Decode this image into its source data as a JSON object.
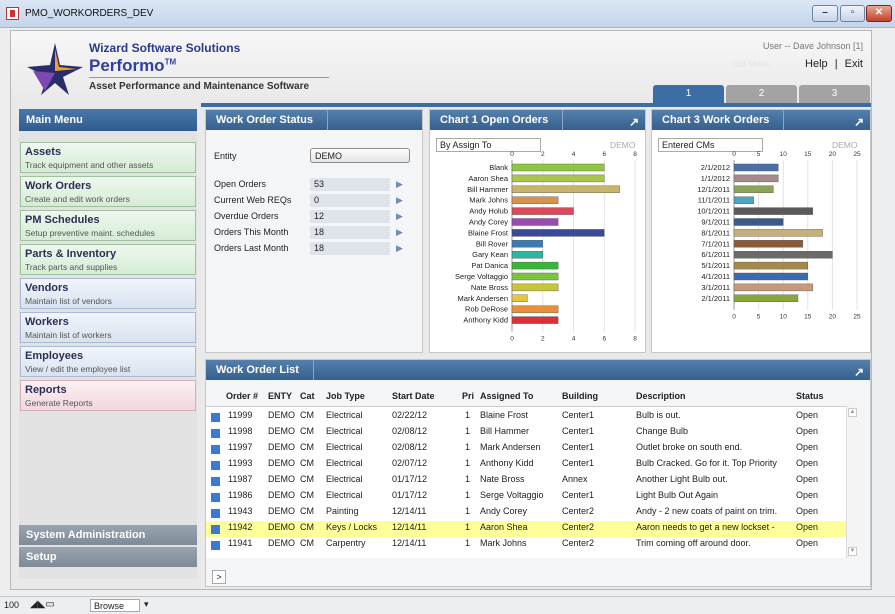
{
  "window": {
    "title": "PMO_WORKORDERS_DEV",
    "min": "–",
    "max": "▫",
    "close": "✕"
  },
  "header": {
    "company": "Wizard Software Solutions",
    "product": "Performo",
    "tm": "TM",
    "tagline": "Asset Performance and Maintenance Software",
    "user": "User -- Dave Johnson [1]",
    "old_menu": "Old Menu",
    "help": "Help",
    "sep": "|",
    "exit": "Exit",
    "tabs": [
      "1",
      "2",
      "3"
    ]
  },
  "sidebar": {
    "title": "Main Menu",
    "items": [
      {
        "title": "Assets",
        "sub": "Track equipment and other assets",
        "style": "green"
      },
      {
        "title": "Work Orders",
        "sub": "Create and edit work orders",
        "style": "green"
      },
      {
        "title": "PM Schedules",
        "sub": "Setup preventive maint. schedules",
        "style": "green"
      },
      {
        "title": "Parts & Inventory",
        "sub": "Track parts and supplies",
        "style": "green"
      },
      {
        "title": "Vendors",
        "sub": "Maintain list of vendors",
        "style": "blue"
      },
      {
        "title": "Workers",
        "sub": "Maintain list of workers",
        "style": "blue"
      },
      {
        "title": "Employees",
        "sub": "View / edit the employee list",
        "style": "blue"
      },
      {
        "title": "Reports",
        "sub": "Generate Reports",
        "style": "pink"
      }
    ],
    "system_admin": "System Administration",
    "setup": "Setup"
  },
  "work_order_status": {
    "title": "Work Order Status",
    "entity_label": "Entity",
    "entity_value": "DEMO",
    "rows": [
      {
        "label": "Open Orders",
        "value": "53"
      },
      {
        "label": "Current Web REQs",
        "value": "0"
      },
      {
        "label": "Overdue Orders",
        "value": "12"
      },
      {
        "label": "Orders This Month",
        "value": "18"
      },
      {
        "label": "Orders Last Month",
        "value": "18"
      }
    ]
  },
  "chart1_panel": {
    "title": "Chart 1 Open Orders",
    "selector": "By Assign To",
    "demo": "DEMO"
  },
  "chart3_panel": {
    "title": "Chart 3 Work Orders",
    "selector": "Entered CMs",
    "demo": "DEMO"
  },
  "chart_data": [
    {
      "type": "bar",
      "orientation": "horizontal",
      "categories": [
        "Blank",
        "Aaron Shea",
        "Bill Hammer",
        "Mark Johns",
        "Andy Holub",
        "Andy Corey",
        "Blaine Frost",
        "Bill Rover",
        "Gary Kean",
        "Pat Danica",
        "Serge Voltaggio",
        "Nate Bross",
        "Mark Andersen",
        "Rob DeRose",
        "Anthony Kidd"
      ],
      "values": [
        6,
        6,
        7,
        3,
        4,
        3,
        6,
        2,
        2,
        3,
        3,
        3,
        1,
        3,
        3
      ],
      "colors": [
        "#8dc63f",
        "#a8c64a",
        "#c8b46a",
        "#d9924a",
        "#d94a5a",
        "#9a4ab5",
        "#3a4a9a",
        "#3a7ab5",
        "#2ab5a5",
        "#3ab53a",
        "#7ac63a",
        "#c6c63a",
        "#e6c63a",
        "#e6903a",
        "#d9303a"
      ],
      "ticks": [
        "0",
        "2",
        "4",
        "6",
        "8"
      ],
      "xlim": [
        0,
        8
      ]
    },
    {
      "type": "bar",
      "orientation": "horizontal",
      "categories": [
        "2/1/2012",
        "1/1/2012",
        "12/1/2011",
        "11/1/2011",
        "10/1/2011",
        "9/1/2011",
        "8/1/2011",
        "7/1/2011",
        "6/1/2011",
        "5/1/2011",
        "4/1/2011",
        "3/1/2011",
        "2/1/2011"
      ],
      "values": [
        9,
        9,
        8,
        4,
        16,
        10,
        18,
        14,
        20,
        15,
        15,
        16,
        13
      ],
      "colors": [
        "#4a6ea5",
        "#a58a8a",
        "#8aa55a",
        "#4aa5c6",
        "#5a5a5a",
        "#3a5a8a",
        "#c6b07a",
        "#8a5a3a",
        "#6a6a6a",
        "#a5884a",
        "#3a6ab0",
        "#c69a7a",
        "#8aa53a"
      ],
      "ticks": [
        "0",
        "5",
        "10",
        "15",
        "20",
        "25"
      ],
      "xlim": [
        0,
        25
      ]
    }
  ],
  "work_order_list": {
    "title": "Work Order List",
    "more": ">",
    "columns": [
      "Order #",
      "ENTY",
      "Cat",
      "Job Type",
      "Start Date",
      "Pri",
      "Assigned To",
      "Building",
      "Description",
      "Status"
    ],
    "rows": [
      [
        "11999",
        "DEMO",
        "CM",
        "Electrical",
        "02/22/12",
        "1",
        "Blaine Frost",
        "Center1",
        "Bulb is out.",
        "Open"
      ],
      [
        "11998",
        "DEMO",
        "CM",
        "Electrical",
        "02/08/12",
        "1",
        "Bill Hammer",
        "Center1",
        "Change Bulb",
        "Open"
      ],
      [
        "11997",
        "DEMO",
        "CM",
        "Electrical",
        "02/08/12",
        "1",
        "Mark Andersen",
        "Center1",
        "Outlet broke on south end.",
        "Open"
      ],
      [
        "11993",
        "DEMO",
        "CM",
        "Electrical",
        "02/07/12",
        "1",
        "Anthony Kidd",
        "Center1",
        "Bulb Cracked.  Go for it.  Top Priority",
        "Open"
      ],
      [
        "11987",
        "DEMO",
        "CM",
        "Electrical",
        "01/17/12",
        "1",
        "Nate Bross",
        "Annex",
        "Another Light Bulb out.",
        "Open"
      ],
      [
        "11986",
        "DEMO",
        "CM",
        "Electrical",
        "01/17/12",
        "1",
        "Serge Voltaggio",
        "Center1",
        "Light Bulb Out Again",
        "Open"
      ],
      [
        "11943",
        "DEMO",
        "CM",
        "Painting",
        "12/14/11",
        "1",
        "Andy Corey",
        "Center2",
        "Andy - 2 new coats of paint on trim.",
        "Open"
      ],
      [
        "11942",
        "DEMO",
        "CM",
        "Keys / Locks",
        "12/14/11",
        "1",
        "Aaron Shea",
        "Center2",
        "Aaron needs to get a new lockset  -",
        "Open"
      ],
      [
        "11941",
        "DEMO",
        "CM",
        "Carpentry",
        "12/14/11",
        "1",
        "Mark Johns",
        "Center2",
        "Trim coming off around door.",
        "Open"
      ]
    ],
    "highlighted_row": 7
  },
  "statusbar": {
    "zoom": "100",
    "mode": "Browse"
  },
  "icons": {
    "expand": "expand-arrow-icon",
    "row_arrow": "play-arrow-icon"
  }
}
